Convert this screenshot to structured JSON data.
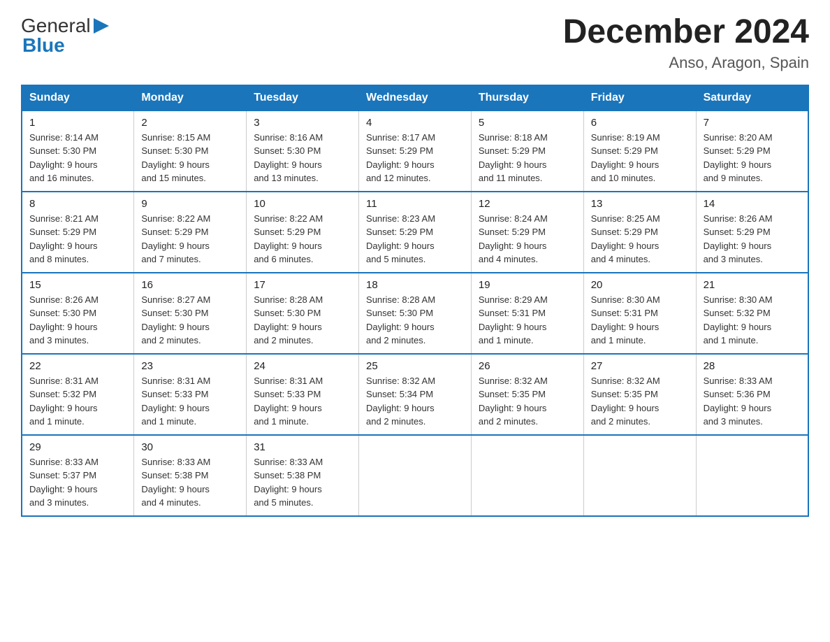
{
  "logo": {
    "text_general": "General",
    "text_blue": "Blue"
  },
  "title": "December 2024",
  "subtitle": "Anso, Aragon, Spain",
  "days_of_week": [
    "Sunday",
    "Monday",
    "Tuesday",
    "Wednesday",
    "Thursday",
    "Friday",
    "Saturday"
  ],
  "weeks": [
    [
      {
        "day": "1",
        "sunrise": "8:14 AM",
        "sunset": "5:30 PM",
        "daylight": "9 hours and 16 minutes."
      },
      {
        "day": "2",
        "sunrise": "8:15 AM",
        "sunset": "5:30 PM",
        "daylight": "9 hours and 15 minutes."
      },
      {
        "day": "3",
        "sunrise": "8:16 AM",
        "sunset": "5:30 PM",
        "daylight": "9 hours and 13 minutes."
      },
      {
        "day": "4",
        "sunrise": "8:17 AM",
        "sunset": "5:29 PM",
        "daylight": "9 hours and 12 minutes."
      },
      {
        "day": "5",
        "sunrise": "8:18 AM",
        "sunset": "5:29 PM",
        "daylight": "9 hours and 11 minutes."
      },
      {
        "day": "6",
        "sunrise": "8:19 AM",
        "sunset": "5:29 PM",
        "daylight": "9 hours and 10 minutes."
      },
      {
        "day": "7",
        "sunrise": "8:20 AM",
        "sunset": "5:29 PM",
        "daylight": "9 hours and 9 minutes."
      }
    ],
    [
      {
        "day": "8",
        "sunrise": "8:21 AM",
        "sunset": "5:29 PM",
        "daylight": "9 hours and 8 minutes."
      },
      {
        "day": "9",
        "sunrise": "8:22 AM",
        "sunset": "5:29 PM",
        "daylight": "9 hours and 7 minutes."
      },
      {
        "day": "10",
        "sunrise": "8:22 AM",
        "sunset": "5:29 PM",
        "daylight": "9 hours and 6 minutes."
      },
      {
        "day": "11",
        "sunrise": "8:23 AM",
        "sunset": "5:29 PM",
        "daylight": "9 hours and 5 minutes."
      },
      {
        "day": "12",
        "sunrise": "8:24 AM",
        "sunset": "5:29 PM",
        "daylight": "9 hours and 4 minutes."
      },
      {
        "day": "13",
        "sunrise": "8:25 AM",
        "sunset": "5:29 PM",
        "daylight": "9 hours and 4 minutes."
      },
      {
        "day": "14",
        "sunrise": "8:26 AM",
        "sunset": "5:29 PM",
        "daylight": "9 hours and 3 minutes."
      }
    ],
    [
      {
        "day": "15",
        "sunrise": "8:26 AM",
        "sunset": "5:30 PM",
        "daylight": "9 hours and 3 minutes."
      },
      {
        "day": "16",
        "sunrise": "8:27 AM",
        "sunset": "5:30 PM",
        "daylight": "9 hours and 2 minutes."
      },
      {
        "day": "17",
        "sunrise": "8:28 AM",
        "sunset": "5:30 PM",
        "daylight": "9 hours and 2 minutes."
      },
      {
        "day": "18",
        "sunrise": "8:28 AM",
        "sunset": "5:30 PM",
        "daylight": "9 hours and 2 minutes."
      },
      {
        "day": "19",
        "sunrise": "8:29 AM",
        "sunset": "5:31 PM",
        "daylight": "9 hours and 1 minute."
      },
      {
        "day": "20",
        "sunrise": "8:30 AM",
        "sunset": "5:31 PM",
        "daylight": "9 hours and 1 minute."
      },
      {
        "day": "21",
        "sunrise": "8:30 AM",
        "sunset": "5:32 PM",
        "daylight": "9 hours and 1 minute."
      }
    ],
    [
      {
        "day": "22",
        "sunrise": "8:31 AM",
        "sunset": "5:32 PM",
        "daylight": "9 hours and 1 minute."
      },
      {
        "day": "23",
        "sunrise": "8:31 AM",
        "sunset": "5:33 PM",
        "daylight": "9 hours and 1 minute."
      },
      {
        "day": "24",
        "sunrise": "8:31 AM",
        "sunset": "5:33 PM",
        "daylight": "9 hours and 1 minute."
      },
      {
        "day": "25",
        "sunrise": "8:32 AM",
        "sunset": "5:34 PM",
        "daylight": "9 hours and 2 minutes."
      },
      {
        "day": "26",
        "sunrise": "8:32 AM",
        "sunset": "5:35 PM",
        "daylight": "9 hours and 2 minutes."
      },
      {
        "day": "27",
        "sunrise": "8:32 AM",
        "sunset": "5:35 PM",
        "daylight": "9 hours and 2 minutes."
      },
      {
        "day": "28",
        "sunrise": "8:33 AM",
        "sunset": "5:36 PM",
        "daylight": "9 hours and 3 minutes."
      }
    ],
    [
      {
        "day": "29",
        "sunrise": "8:33 AM",
        "sunset": "5:37 PM",
        "daylight": "9 hours and 3 minutes."
      },
      {
        "day": "30",
        "sunrise": "8:33 AM",
        "sunset": "5:38 PM",
        "daylight": "9 hours and 4 minutes."
      },
      {
        "day": "31",
        "sunrise": "8:33 AM",
        "sunset": "5:38 PM",
        "daylight": "9 hours and 5 minutes."
      },
      {
        "day": "",
        "sunrise": "",
        "sunset": "",
        "daylight": ""
      },
      {
        "day": "",
        "sunrise": "",
        "sunset": "",
        "daylight": ""
      },
      {
        "day": "",
        "sunrise": "",
        "sunset": "",
        "daylight": ""
      },
      {
        "day": "",
        "sunrise": "",
        "sunset": "",
        "daylight": ""
      }
    ]
  ]
}
